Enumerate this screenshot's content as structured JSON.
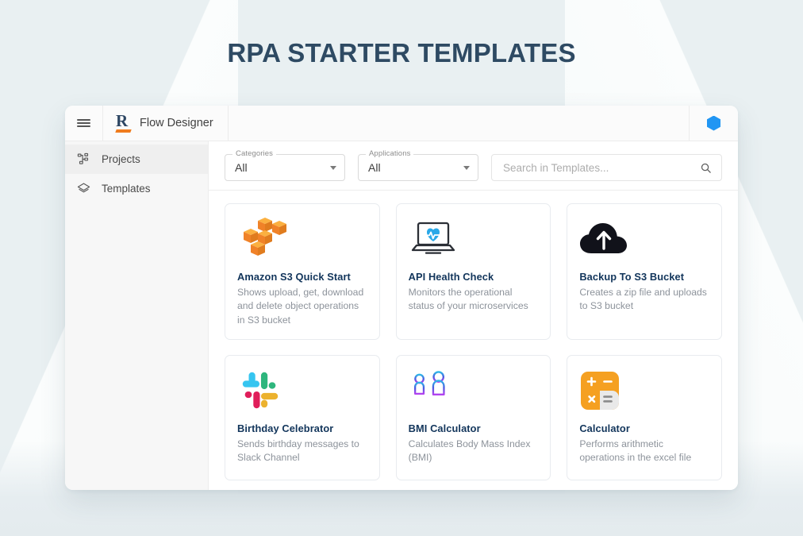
{
  "page": {
    "title": "RPA STARTER TEMPLATES",
    "title_color": "#2e4a63",
    "background_color": "#e9f0f2"
  },
  "appbar": {
    "menu_icon": "hamburger-icon",
    "logo_letter": "R",
    "logo_accent_color": "#f07c1e",
    "product_name": "Flow Designer",
    "account_icon": "hexagon-icon",
    "account_icon_color": "#2196f3"
  },
  "sidebar": {
    "items": [
      {
        "label": "Projects",
        "icon": "hierarchy-icon",
        "active": true
      },
      {
        "label": "Templates",
        "icon": "layers-icon",
        "active": false
      }
    ]
  },
  "toolbar": {
    "filters": [
      {
        "label": "Categories",
        "value": "All",
        "icon": "chevron-down-icon"
      },
      {
        "label": "Applications",
        "value": "All",
        "icon": "chevron-down-icon"
      }
    ],
    "search": {
      "placeholder": "Search in Templates...",
      "value": "",
      "icon": "search-icon"
    }
  },
  "templates": [
    {
      "title": "Amazon S3 Quick Start",
      "description": "Shows upload, get, download and delete object operations in S3 bucket",
      "icon": "aws-s3-cubes-icon",
      "icon_color": "#f08228"
    },
    {
      "title": "API Health Check",
      "description": "Monitors the operational status of your microservices",
      "icon": "laptop-heartbeat-icon",
      "icon_color": "#29a8e8"
    },
    {
      "title": "Backup To S3 Bucket",
      "description": "Creates a zip file and uploads to S3 bucket",
      "icon": "cloud-upload-icon",
      "icon_color": "#11121a"
    },
    {
      "title": "Birthday Celebrator",
      "description": "Sends birthday messages to Slack Channel",
      "icon": "slack-icon",
      "icon_color": "#36c5f0"
    },
    {
      "title": "BMI Calculator",
      "description": "Calculates Body Mass Index (BMI)",
      "icon": "two-people-measure-icon",
      "icon_color": "#3d5af1"
    },
    {
      "title": "Calculator",
      "description": "Performs arithmetic operations in the excel file",
      "icon": "calculator-icon",
      "icon_color": "#f5a021"
    }
  ]
}
